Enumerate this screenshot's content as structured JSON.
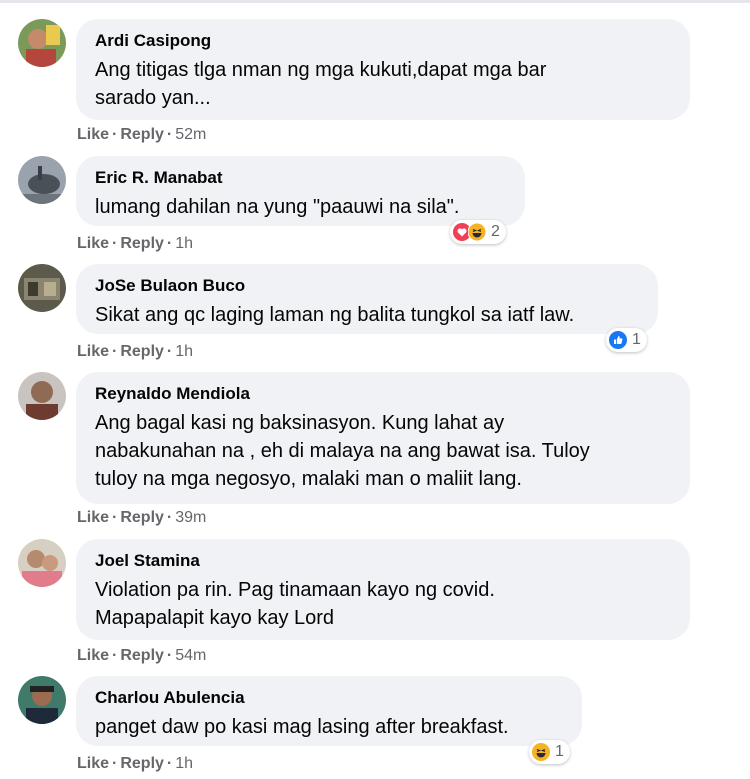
{
  "actions": {
    "like": "Like",
    "reply": "Reply"
  },
  "comments": [
    {
      "author": "Ardi Casipong",
      "lines": [
        "Ang titigas tlga nman ng mga kukuti,dapat mga bar",
        "sarado yan..."
      ],
      "time": "52m"
    },
    {
      "author": "Eric R. Manabat",
      "lines": [
        "lumang dahilan na yung \"paauwi na sila\"."
      ],
      "time": "1h",
      "reactions": {
        "icons": [
          "love-icon",
          "haha-icon"
        ],
        "count": "2"
      }
    },
    {
      "author": "JoSe Bulaon Buco",
      "lines": [
        "Sikat ang qc laging laman ng balita tungkol sa iatf law."
      ],
      "time": "1h",
      "reactions": {
        "icons": [
          "like-icon"
        ],
        "count": "1"
      }
    },
    {
      "author": "Reynaldo Mendiola",
      "lines": [
        "Ang bagal kasi ng baksinasyon. Kung lahat ay",
        "nabakunahan na , eh di malaya na ang bawat isa. Tuloy",
        "tuloy na mga negosyo, malaki man o maliit lang."
      ],
      "time": "39m"
    },
    {
      "author": "Joel Stamina",
      "lines": [
        "Violation pa rin. Pag tinamaan kayo ng covid.",
        "Mapapalapit kayo kay Lord"
      ],
      "time": "54m"
    },
    {
      "author": "Charlou Abulencia",
      "lines": [
        "panget daw po kasi mag lasing after breakfast."
      ],
      "time": "1h",
      "reactions": {
        "icons": [
          "haha-icon"
        ],
        "count": "1"
      }
    }
  ],
  "colors": {
    "bubble": "#f0f2f5",
    "meta": "#65676b",
    "like": "#1877f2",
    "love": "#f33e58",
    "haha": "#f7b125"
  }
}
